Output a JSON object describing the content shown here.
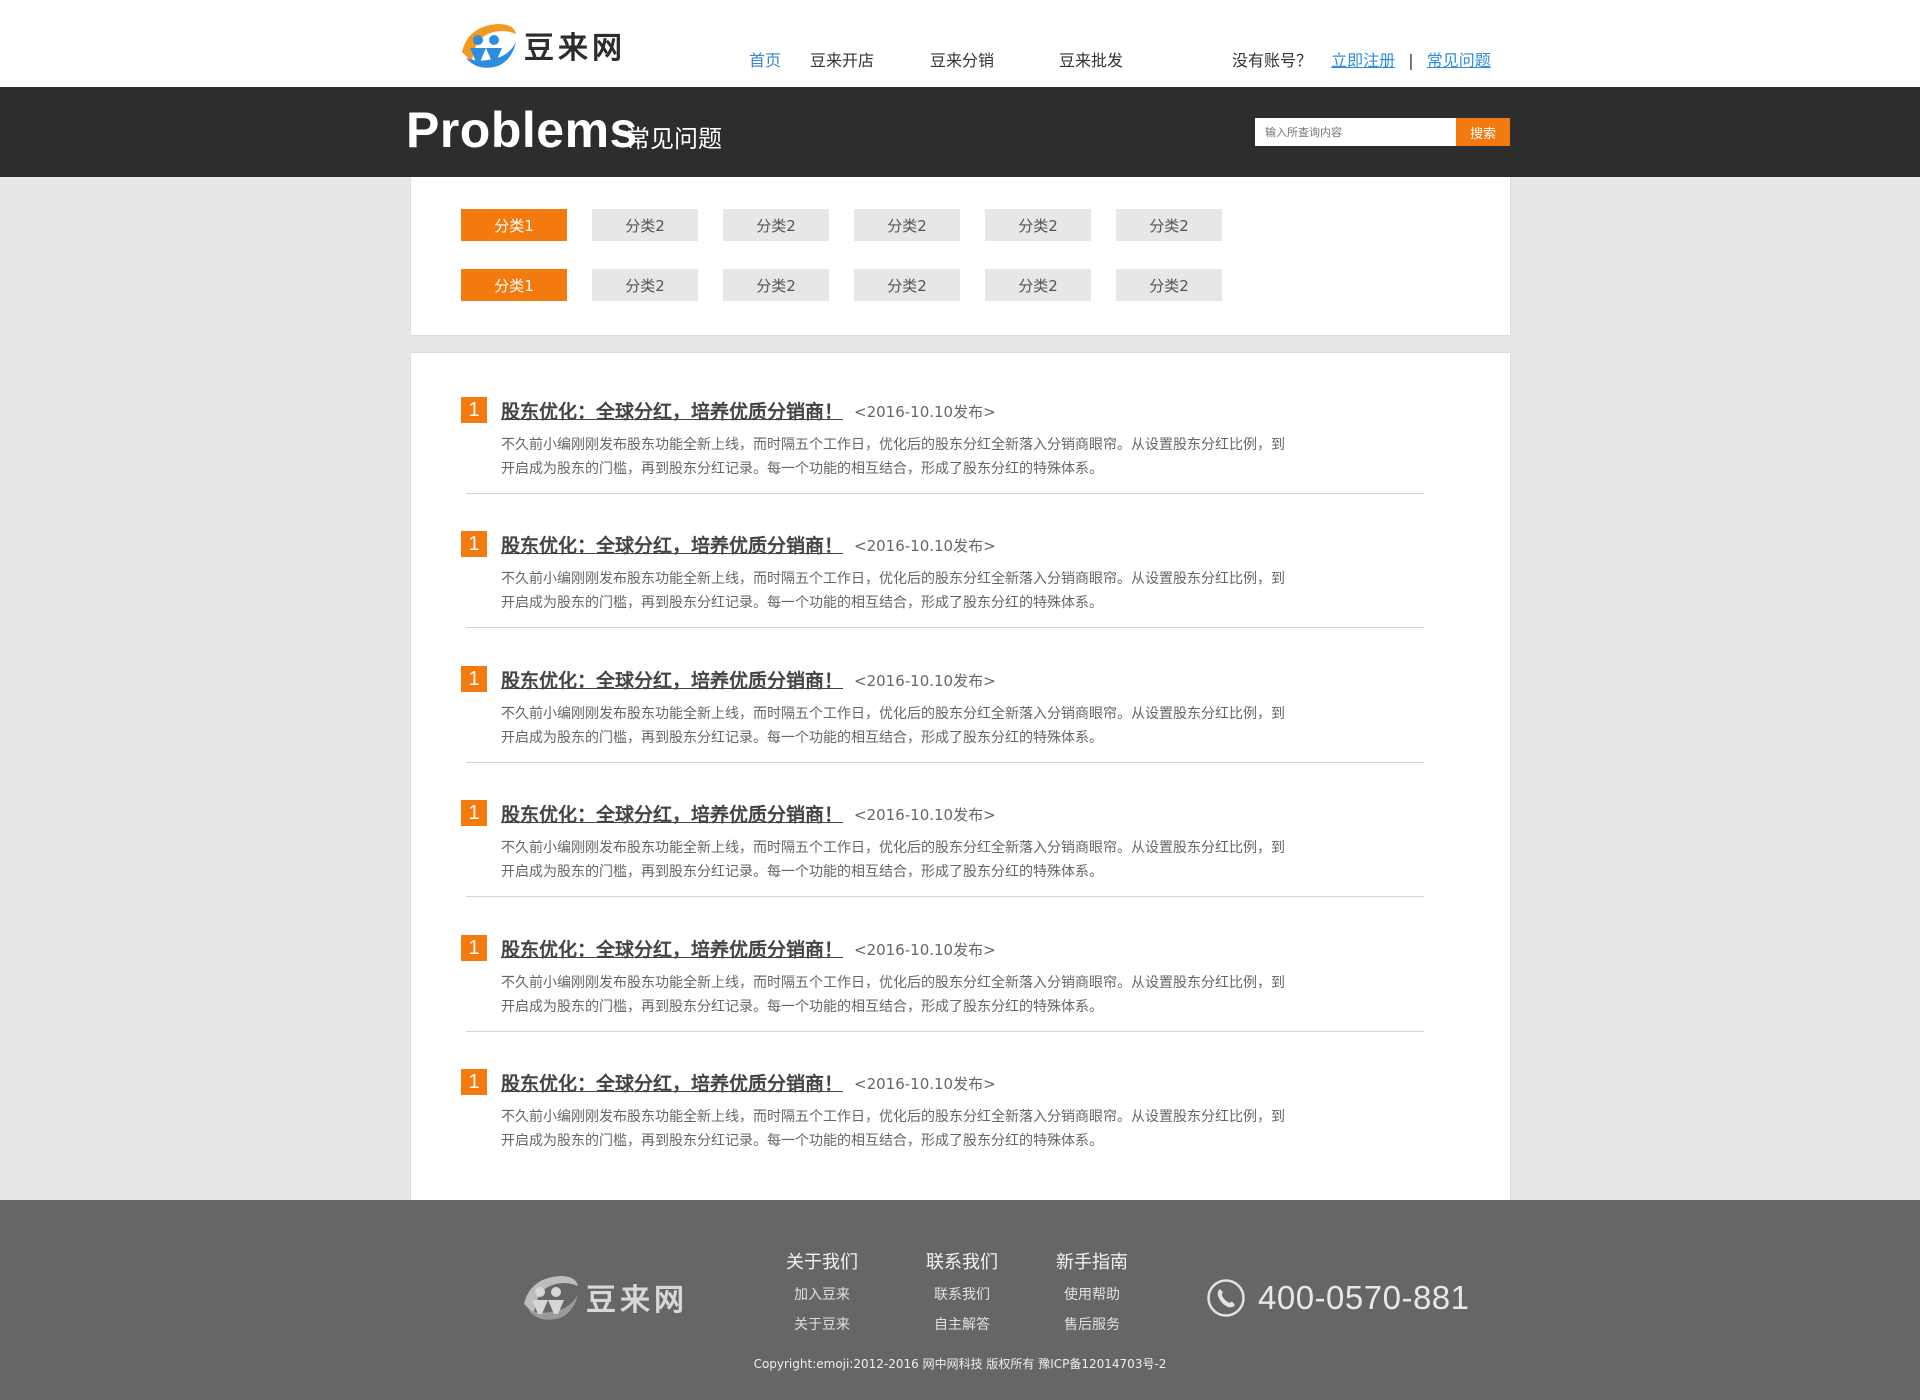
{
  "header": {
    "logo_text": "豆来网",
    "nav": [
      {
        "label": "首页",
        "active": true
      },
      {
        "label": "豆来开店",
        "active": false
      },
      {
        "label": "豆来分销",
        "active": false
      },
      {
        "label": "豆来批发",
        "active": false
      }
    ],
    "auth": {
      "question": "没有账号？",
      "register": "立即注册",
      "separator": "|",
      "faq": "常见问题"
    }
  },
  "banner": {
    "title_en": "Problems",
    "title_cn": "常见问题",
    "search_placeholder": "输入所查询内容",
    "search_button": "搜索"
  },
  "categories": {
    "row1": [
      "分类1",
      "分类2",
      "分类2",
      "分类2",
      "分类2",
      "分类2"
    ],
    "row2": [
      "分类1",
      "分类2",
      "分类2",
      "分类2",
      "分类2",
      "分类2"
    ],
    "active_index": 0
  },
  "articles": [
    {
      "num": "1",
      "title": "股东优化：全球分红，培养优质分销商！",
      "date": "<2016-10.10发布>",
      "desc": "不久前小编刚刚发布股东功能全新上线，而时隔五个工作日，优化后的股东分红全新落入分销商眼帘。从设置股东分红比例，到开启成为股东的门槛，再到股东分红记录。每一个功能的相互结合，形成了股东分红的特殊体系。"
    },
    {
      "num": "1",
      "title": "股东优化：全球分红，培养优质分销商！",
      "date": "<2016-10.10发布>",
      "desc": "不久前小编刚刚发布股东功能全新上线，而时隔五个工作日，优化后的股东分红全新落入分销商眼帘。从设置股东分红比例，到开启成为股东的门槛，再到股东分红记录。每一个功能的相互结合，形成了股东分红的特殊体系。"
    },
    {
      "num": "1",
      "title": "股东优化：全球分红，培养优质分销商！",
      "date": "<2016-10.10发布>",
      "desc": "不久前小编刚刚发布股东功能全新上线，而时隔五个工作日，优化后的股东分红全新落入分销商眼帘。从设置股东分红比例，到开启成为股东的门槛，再到股东分红记录。每一个功能的相互结合，形成了股东分红的特殊体系。"
    },
    {
      "num": "1",
      "title": "股东优化：全球分红，培养优质分销商！",
      "date": "<2016-10.10发布>",
      "desc": "不久前小编刚刚发布股东功能全新上线，而时隔五个工作日，优化后的股东分红全新落入分销商眼帘。从设置股东分红比例，到开启成为股东的门槛，再到股东分红记录。每一个功能的相互结合，形成了股东分红的特殊体系。"
    },
    {
      "num": "1",
      "title": "股东优化：全球分红，培养优质分销商！",
      "date": "<2016-10.10发布>",
      "desc": "不久前小编刚刚发布股东功能全新上线，而时隔五个工作日，优化后的股东分红全新落入分销商眼帘。从设置股东分红比例，到开启成为股东的门槛，再到股东分红记录。每一个功能的相互结合，形成了股东分红的特殊体系。"
    },
    {
      "num": "1",
      "title": "股东优化：全球分红，培养优质分销商！",
      "date": "<2016-10.10发布>",
      "desc": "不久前小编刚刚发布股东功能全新上线，而时隔五个工作日，优化后的股东分红全新落入分销商眼帘。从设置股东分红比例，到开启成为股东的门槛，再到股东分红记录。每一个功能的相互结合，形成了股东分红的特殊体系。"
    }
  ],
  "footer": {
    "logo_text": "豆来网",
    "columns": [
      {
        "heading": "关于我们",
        "links": [
          "加入豆来",
          "关于豆来"
        ]
      },
      {
        "heading": "联系我们",
        "links": [
          "联系我们",
          "自主解答"
        ]
      },
      {
        "heading": "新手指南",
        "links": [
          "使用帮助",
          "售后服务"
        ]
      }
    ],
    "phone": "400-0570-881",
    "copyright": "Copyright:emoji:2012-2016 网中网科技 版权所有 豫ICP备12014703号-2"
  },
  "colors": {
    "accent": "#f27a0f",
    "link": "#2e8ddc",
    "banner_bg": "#2d2d2d",
    "footer_bg": "#666666"
  }
}
